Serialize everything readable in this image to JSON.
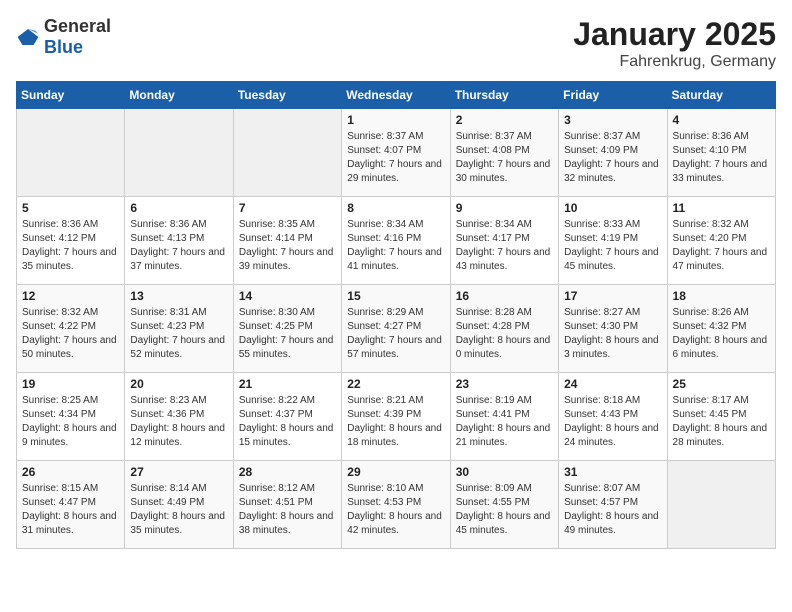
{
  "header": {
    "logo_general": "General",
    "logo_blue": "Blue",
    "month": "January 2025",
    "location": "Fahrenkrug, Germany"
  },
  "days_of_week": [
    "Sunday",
    "Monday",
    "Tuesday",
    "Wednesday",
    "Thursday",
    "Friday",
    "Saturday"
  ],
  "weeks": [
    [
      {
        "day": "",
        "empty": true
      },
      {
        "day": "",
        "empty": true
      },
      {
        "day": "",
        "empty": true
      },
      {
        "day": "1",
        "sunrise": "8:37 AM",
        "sunset": "4:07 PM",
        "daylight": "7 hours and 29 minutes."
      },
      {
        "day": "2",
        "sunrise": "8:37 AM",
        "sunset": "4:08 PM",
        "daylight": "7 hours and 30 minutes."
      },
      {
        "day": "3",
        "sunrise": "8:37 AM",
        "sunset": "4:09 PM",
        "daylight": "7 hours and 32 minutes."
      },
      {
        "day": "4",
        "sunrise": "8:36 AM",
        "sunset": "4:10 PM",
        "daylight": "7 hours and 33 minutes."
      }
    ],
    [
      {
        "day": "5",
        "sunrise": "8:36 AM",
        "sunset": "4:12 PM",
        "daylight": "7 hours and 35 minutes."
      },
      {
        "day": "6",
        "sunrise": "8:36 AM",
        "sunset": "4:13 PM",
        "daylight": "7 hours and 37 minutes."
      },
      {
        "day": "7",
        "sunrise": "8:35 AM",
        "sunset": "4:14 PM",
        "daylight": "7 hours and 39 minutes."
      },
      {
        "day": "8",
        "sunrise": "8:34 AM",
        "sunset": "4:16 PM",
        "daylight": "7 hours and 41 minutes."
      },
      {
        "day": "9",
        "sunrise": "8:34 AM",
        "sunset": "4:17 PM",
        "daylight": "7 hours and 43 minutes."
      },
      {
        "day": "10",
        "sunrise": "8:33 AM",
        "sunset": "4:19 PM",
        "daylight": "7 hours and 45 minutes."
      },
      {
        "day": "11",
        "sunrise": "8:32 AM",
        "sunset": "4:20 PM",
        "daylight": "7 hours and 47 minutes."
      }
    ],
    [
      {
        "day": "12",
        "sunrise": "8:32 AM",
        "sunset": "4:22 PM",
        "daylight": "7 hours and 50 minutes."
      },
      {
        "day": "13",
        "sunrise": "8:31 AM",
        "sunset": "4:23 PM",
        "daylight": "7 hours and 52 minutes."
      },
      {
        "day": "14",
        "sunrise": "8:30 AM",
        "sunset": "4:25 PM",
        "daylight": "7 hours and 55 minutes."
      },
      {
        "day": "15",
        "sunrise": "8:29 AM",
        "sunset": "4:27 PM",
        "daylight": "7 hours and 57 minutes."
      },
      {
        "day": "16",
        "sunrise": "8:28 AM",
        "sunset": "4:28 PM",
        "daylight": "8 hours and 0 minutes."
      },
      {
        "day": "17",
        "sunrise": "8:27 AM",
        "sunset": "4:30 PM",
        "daylight": "8 hours and 3 minutes."
      },
      {
        "day": "18",
        "sunrise": "8:26 AM",
        "sunset": "4:32 PM",
        "daylight": "8 hours and 6 minutes."
      }
    ],
    [
      {
        "day": "19",
        "sunrise": "8:25 AM",
        "sunset": "4:34 PM",
        "daylight": "8 hours and 9 minutes."
      },
      {
        "day": "20",
        "sunrise": "8:23 AM",
        "sunset": "4:36 PM",
        "daylight": "8 hours and 12 minutes."
      },
      {
        "day": "21",
        "sunrise": "8:22 AM",
        "sunset": "4:37 PM",
        "daylight": "8 hours and 15 minutes."
      },
      {
        "day": "22",
        "sunrise": "8:21 AM",
        "sunset": "4:39 PM",
        "daylight": "8 hours and 18 minutes."
      },
      {
        "day": "23",
        "sunrise": "8:19 AM",
        "sunset": "4:41 PM",
        "daylight": "8 hours and 21 minutes."
      },
      {
        "day": "24",
        "sunrise": "8:18 AM",
        "sunset": "4:43 PM",
        "daylight": "8 hours and 24 minutes."
      },
      {
        "day": "25",
        "sunrise": "8:17 AM",
        "sunset": "4:45 PM",
        "daylight": "8 hours and 28 minutes."
      }
    ],
    [
      {
        "day": "26",
        "sunrise": "8:15 AM",
        "sunset": "4:47 PM",
        "daylight": "8 hours and 31 minutes."
      },
      {
        "day": "27",
        "sunrise": "8:14 AM",
        "sunset": "4:49 PM",
        "daylight": "8 hours and 35 minutes."
      },
      {
        "day": "28",
        "sunrise": "8:12 AM",
        "sunset": "4:51 PM",
        "daylight": "8 hours and 38 minutes."
      },
      {
        "day": "29",
        "sunrise": "8:10 AM",
        "sunset": "4:53 PM",
        "daylight": "8 hours and 42 minutes."
      },
      {
        "day": "30",
        "sunrise": "8:09 AM",
        "sunset": "4:55 PM",
        "daylight": "8 hours and 45 minutes."
      },
      {
        "day": "31",
        "sunrise": "8:07 AM",
        "sunset": "4:57 PM",
        "daylight": "8 hours and 49 minutes."
      },
      {
        "day": "",
        "empty": true
      }
    ]
  ]
}
